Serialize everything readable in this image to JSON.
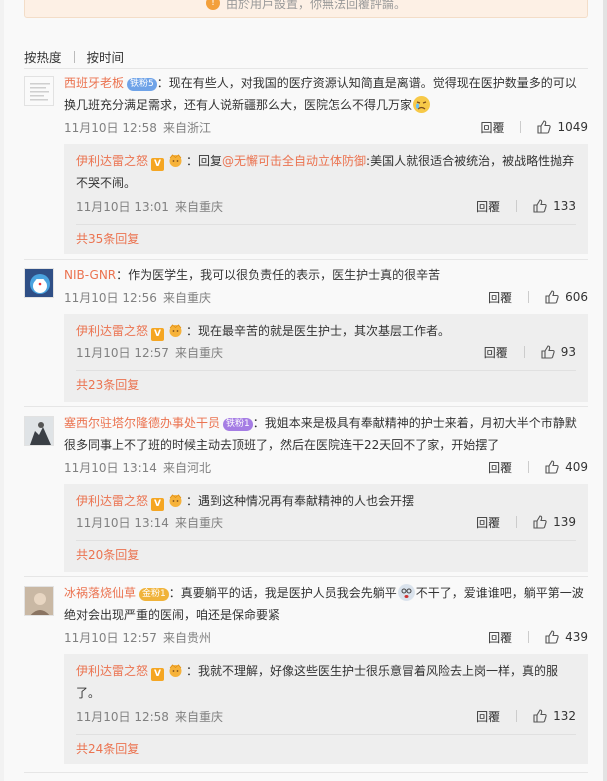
{
  "notice": {
    "text": "由於用戶設置，你無法回覆評論。"
  },
  "sort": {
    "by_heat": "按热度",
    "by_time": "按时间"
  },
  "labels": {
    "reply": "回覆"
  },
  "colors": {
    "username": "#eb7350",
    "sub_bg": "#eeeeee"
  },
  "comments": [
    {
      "user": "西班牙老板",
      "badge": "铁粉5",
      "text": "：现在有些人，对我国的医疗资源认知简直是离谱。觉得现在医护数量多的可以换几班充分满足需求，还有人说新疆那么大，医院怎么不得几万家",
      "time": "11月10日 12:58",
      "source": "来自浙江",
      "likes": "1049",
      "reply": {
        "user": "伊利达雷之怒",
        "text_prefix": "：回复",
        "mention": "@无懈可击全自动立体防御",
        "text": ":美国人就很适合被统治，被战略性抛弃不哭不闹。",
        "time": "11月10日 13:01",
        "source": "来自重庆",
        "likes": "133"
      },
      "more": "共35条回复"
    },
    {
      "user": "NIB-GNR",
      "badge": "",
      "text": "：作为医学生，我可以很负责任的表示，医生护士真的很辛苦",
      "time": "11月10日 12:56",
      "source": "来自重庆",
      "likes": "606",
      "reply": {
        "user": "伊利达雷之怒",
        "text_prefix": "：",
        "mention": "",
        "text": "现在最辛苦的就是医生护士，其次基层工作者。",
        "time": "11月10日 12:57",
        "source": "来自重庆",
        "likes": "93"
      },
      "more": "共23条回复"
    },
    {
      "user": "塞西尔驻塔尔隆德办事处干员",
      "badge": "铁粉1",
      "text": "：我姐本来是极具有奉献精神的护士来着，月初大半个市静默很多同事上不了班的时候主动去顶班了，然后在医院连干22天回不了家，开始摆了",
      "time": "11月10日 13:14",
      "source": "来自河北",
      "likes": "409",
      "reply": {
        "user": "伊利达雷之怒",
        "text_prefix": "：",
        "mention": "",
        "text": "遇到这种情况再有奉献精神的人也会开摆",
        "time": "11月10日 13:14",
        "source": "来自重庆",
        "likes": "139"
      },
      "more": "共20条回复"
    },
    {
      "user": "冰祸落烧仙草",
      "badge": "金粉1",
      "text_a": "：真要躺平的话，我是医护人员我会先躺平",
      "text_b": "不干了，爱谁谁吧，躺平第一波绝对会出现严重的医闹，咱还是保命要紧",
      "time": "11月10日 12:57",
      "source": "来自贵州",
      "likes": "439",
      "reply": {
        "user": "伊利达雷之怒",
        "text_prefix": "：",
        "mention": "",
        "text": "我就不理解，好像这些医生护士很乐意冒着风险去上岗一样，真的服了。",
        "time": "11月10日 12:58",
        "source": "来自重庆",
        "likes": "132"
      },
      "more": "共24条回复"
    }
  ]
}
